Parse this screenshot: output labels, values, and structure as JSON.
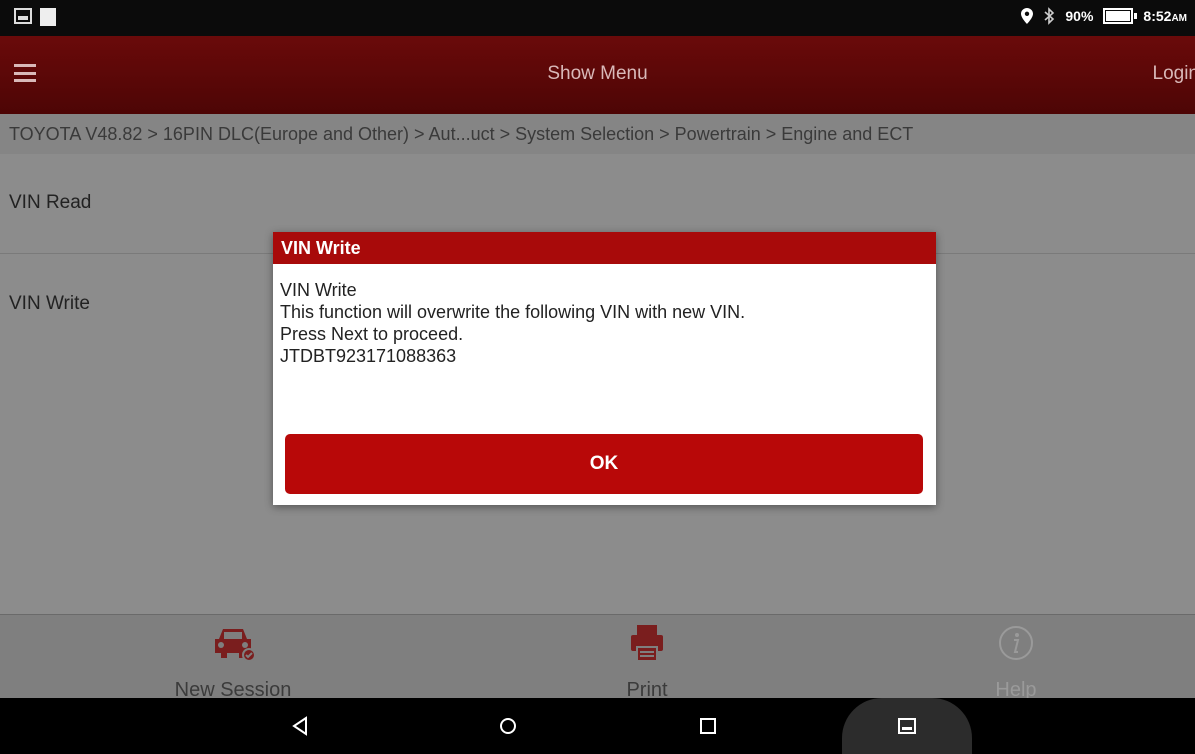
{
  "status_bar": {
    "battery": "90%",
    "time": "8:52",
    "time_suffix": "AM",
    "icons": [
      "gallery-icon",
      "notification-square-icon",
      "location-icon",
      "bluetooth-icon",
      "battery-icon"
    ]
  },
  "app_bar": {
    "title": "Show Menu",
    "login": "Login"
  },
  "breadcrumb": "TOYOTA V48.82 > 16PIN DLC(Europe and Other) > Aut...uct > System Selection > Powertrain > Engine and ECT",
  "list": [
    {
      "label": "VIN Read"
    },
    {
      "label": "VIN Write"
    }
  ],
  "dialog": {
    "title": "VIN Write",
    "lines": [
      "VIN Write",
      "This function will overwrite the following VIN with new VIN.",
      "Press Next to proceed.",
      "JTDBT923171088363"
    ],
    "ok_label": "OK"
  },
  "toolbar": {
    "new_session": "New Session",
    "print": "Print",
    "help": "Help"
  },
  "colors": {
    "app_bar": "#5a0707",
    "dialog_header": "#a80a0a",
    "ok_button": "#b80808",
    "overlay_gray": "#8c8c8c"
  }
}
